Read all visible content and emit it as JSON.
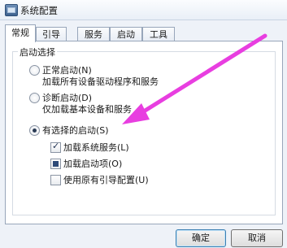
{
  "window": {
    "title": "系统配置"
  },
  "tabs": [
    {
      "label": "常规",
      "active": true
    },
    {
      "label": "引导"
    },
    {
      "label": "服务"
    },
    {
      "label": "启动"
    },
    {
      "label": "工具"
    }
  ],
  "startup": {
    "legend": "启动选择",
    "normal": {
      "label": "正常启动(N)",
      "desc": "加载所有设备驱动程序和服务"
    },
    "diagnostic": {
      "label": "诊断启动(D)",
      "desc": "仅加载基本设备和服务"
    },
    "selective": {
      "label": "有选择的启动(S)",
      "options": [
        {
          "label": "加载系统服务(L)",
          "state": "checked"
        },
        {
          "label": "加载启动项(O)",
          "state": "partial"
        },
        {
          "label": "使用原有引导配置(U)",
          "state": "unchecked"
        }
      ]
    }
  },
  "buttons": {
    "ok": "确定",
    "cancel": "取消"
  },
  "annotation": {
    "arrow_color": "#e83ee0"
  }
}
